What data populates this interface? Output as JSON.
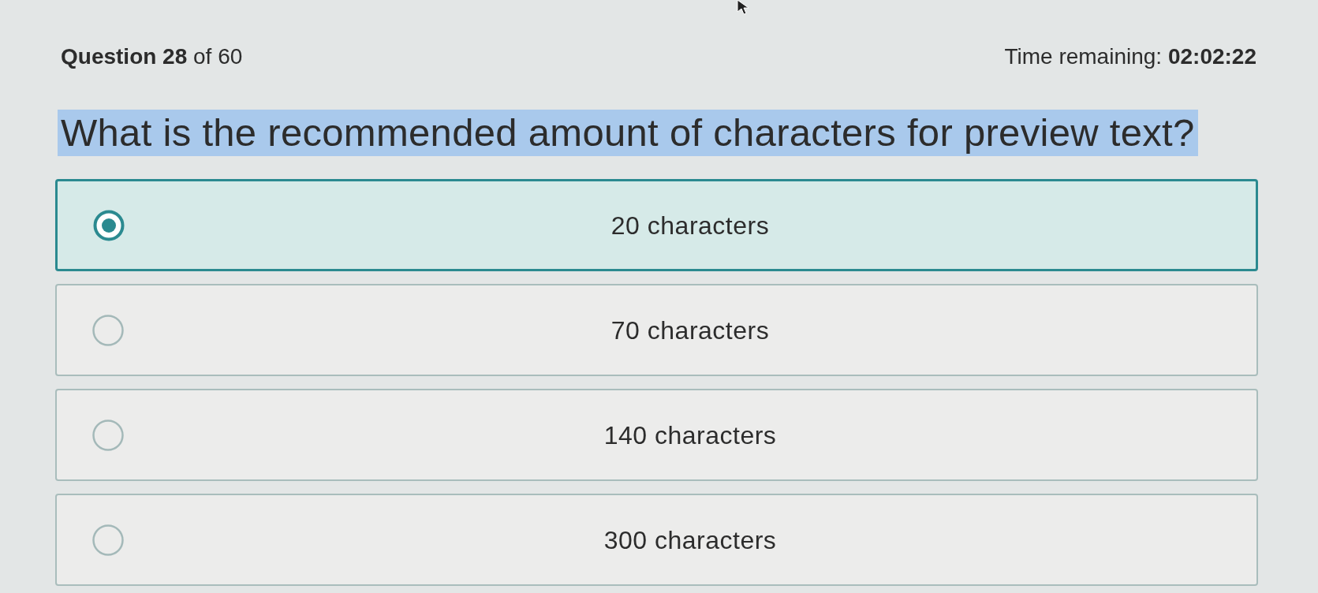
{
  "header": {
    "question_number": "**Question 28** of 60",
    "timer": "Time remaining: **02:02:22**"
  },
  "question": {
    "text": "What is the recommended amount of characters for preview text?",
    "highlighted": true
  },
  "options": [
    {
      "label": "20 characters",
      "selected": true
    },
    {
      "label": "70 characters",
      "selected": false
    },
    {
      "label": "140 characters",
      "selected": false
    },
    {
      "label": "300 characters",
      "selected": false
    }
  ]
}
